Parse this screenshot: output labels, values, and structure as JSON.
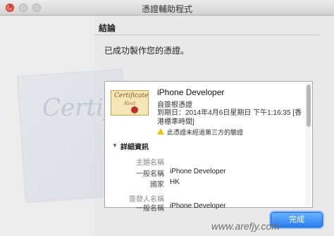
{
  "window": {
    "title": "憑證輔助程式"
  },
  "controls": {
    "close_glyph": "×"
  },
  "header": {
    "heading": "結論",
    "message": "已成功製作您的憑證。"
  },
  "certificate": {
    "icon_title": "Certificate",
    "icon_sub": "Root",
    "name": "iPhone Developer",
    "type": "自簽根憑證",
    "expiry": "到期日：2014年4月6日星期日 下午1:16:35 [香港標準時間]",
    "warning": "此憑證未經過第三方的驗證"
  },
  "details": {
    "disclosure_glyph": "▼",
    "label": "詳細資訊",
    "subject_label": "主題名稱",
    "subject_common_name_label": "一般名稱",
    "subject_common_name": "iPhone Developer",
    "subject_country_label": "國家",
    "subject_country": "HK",
    "issuer_label": "簽發人名稱",
    "issuer_common_name_label": "一般名稱",
    "issuer_common_name": "iPhone Developer"
  },
  "footer": {
    "done_button": "完成",
    "watermark": "www.arefjy.com"
  }
}
